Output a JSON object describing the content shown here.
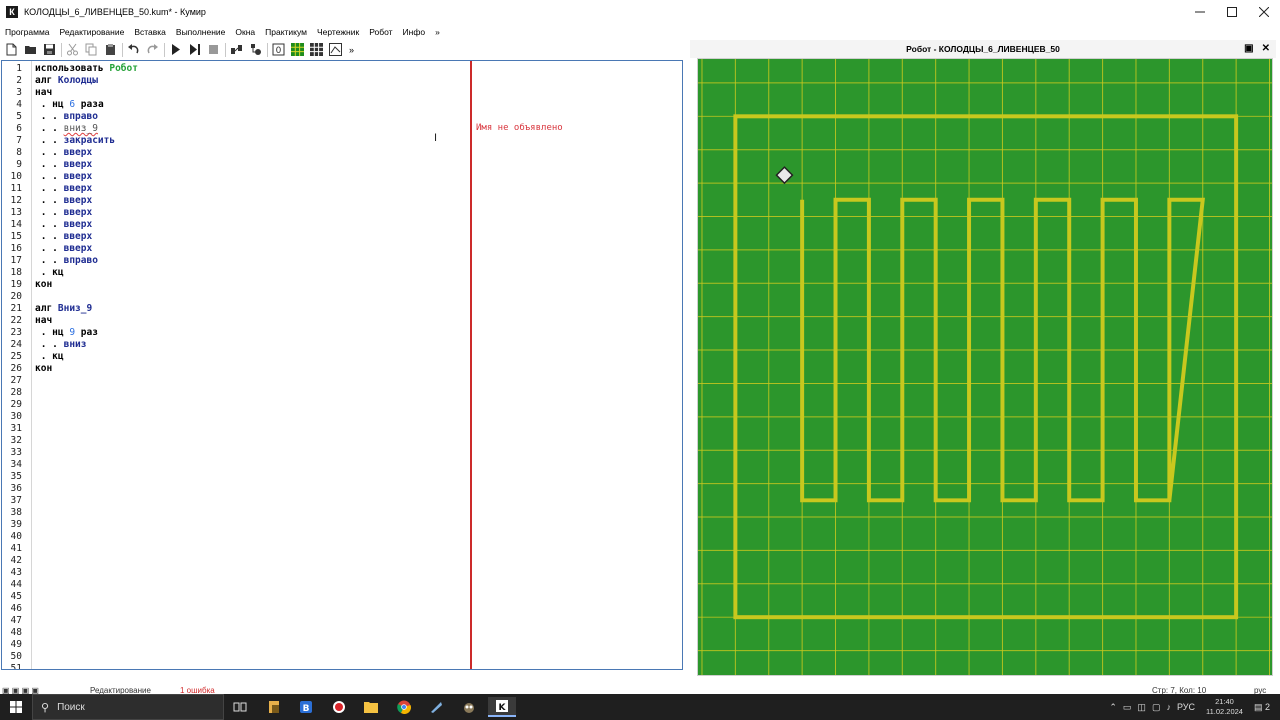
{
  "window": {
    "title": "КОЛОДЦЫ_6_ЛИВЕНЦЕВ_50.kum* - Кумир",
    "app_icon": "К"
  },
  "menu": [
    "Программа",
    "Редактирование",
    "Вставка",
    "Выполнение",
    "Окна",
    "Практикум",
    "Чертежник",
    "Робот",
    "Инфо",
    "»"
  ],
  "toolbar_more": "»",
  "editor": {
    "line_count": 51,
    "lines": [
      [
        [
          "kw",
          "использовать "
        ],
        [
          "grn",
          "Робот"
        ]
      ],
      [
        [
          "kw",
          "алг "
        ],
        [
          "id",
          "Колодцы"
        ]
      ],
      [
        [
          "kw",
          "нач"
        ]
      ],
      [
        [
          "dot",
          " . "
        ],
        [
          "kw",
          "нц "
        ],
        [
          "num",
          "6"
        ],
        [
          "kw",
          " раза"
        ]
      ],
      [
        [
          "dot",
          " . . "
        ],
        [
          "id",
          "вправо"
        ]
      ],
      [
        [
          "dot",
          " . . "
        ],
        [
          "err",
          "вниз_9"
        ]
      ],
      [
        [
          "dot",
          " . . "
        ],
        [
          "id",
          "закрасить"
        ]
      ],
      [
        [
          "dot",
          " . . "
        ],
        [
          "id",
          "вверх"
        ]
      ],
      [
        [
          "dot",
          " . . "
        ],
        [
          "id",
          "вверх"
        ]
      ],
      [
        [
          "dot",
          " . . "
        ],
        [
          "id",
          "вверх"
        ]
      ],
      [
        [
          "dot",
          " . . "
        ],
        [
          "id",
          "вверх"
        ]
      ],
      [
        [
          "dot",
          " . . "
        ],
        [
          "id",
          "вверх"
        ]
      ],
      [
        [
          "dot",
          " . . "
        ],
        [
          "id",
          "вверх"
        ]
      ],
      [
        [
          "dot",
          " . . "
        ],
        [
          "id",
          "вверх"
        ]
      ],
      [
        [
          "dot",
          " . . "
        ],
        [
          "id",
          "вверх"
        ]
      ],
      [
        [
          "dot",
          " . . "
        ],
        [
          "id",
          "вверх"
        ]
      ],
      [
        [
          "dot",
          " . . "
        ],
        [
          "id",
          "вправо"
        ]
      ],
      [
        [
          "dot",
          " . "
        ],
        [
          "kw",
          "кц"
        ]
      ],
      [
        [
          "kw",
          "кон"
        ]
      ],
      [],
      [
        [
          "kw",
          "алг "
        ],
        [
          "id",
          "Вниз_9"
        ]
      ],
      [
        [
          "kw",
          "нач"
        ]
      ],
      [
        [
          "dot",
          " . "
        ],
        [
          "kw",
          "нц "
        ],
        [
          "num",
          "9"
        ],
        [
          "kw",
          " раз"
        ]
      ],
      [
        [
          "dot",
          " . . "
        ],
        [
          "id",
          "вниз"
        ]
      ],
      [
        [
          "dot",
          " . "
        ],
        [
          "kw",
          "кц"
        ]
      ],
      [
        [
          "kw",
          "кон"
        ]
      ]
    ],
    "margin_message": "Имя не объявлено"
  },
  "robot_panel": {
    "title": "Робот  - КОЛОДЦЫ_6_ЛИВЕНЦЕВ_50",
    "grid": {
      "cols": 17,
      "rows": 18
    },
    "robot_cell": {
      "col": 2,
      "row": 3
    }
  },
  "status": {
    "mode": "Редактирование",
    "errors": "1 ошибка",
    "position": "Стр: 7, Кол: 10",
    "lang": "рус"
  },
  "taskbar": {
    "search_placeholder": "Поиск",
    "lang": "РУС",
    "time": "21:40",
    "date": "11.02.2024",
    "notifications": "2"
  },
  "colors": {
    "field_green": "#2c962c",
    "wall_yellow": "#c8c81e",
    "grid_line": "#c8c81e",
    "margin_red": "#cc2a2a",
    "error_text": "#d9363e"
  }
}
